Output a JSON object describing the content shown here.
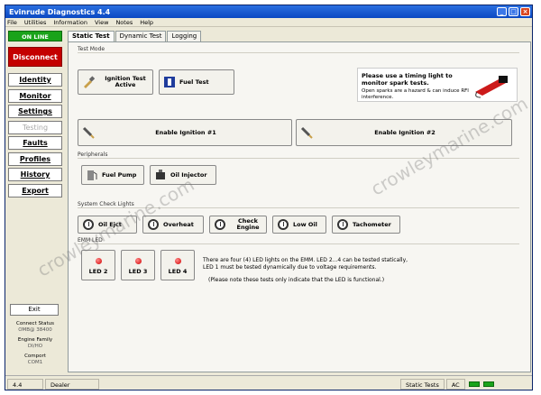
{
  "window": {
    "title": "Evinrude Diagnostics 4.4"
  },
  "menu": [
    "File",
    "Utilities",
    "Information",
    "View",
    "Notes",
    "Help"
  ],
  "sidebar": {
    "status": "ON LINE",
    "disconnect": "Disconnect",
    "items": [
      {
        "label": "Identity",
        "enabled": true
      },
      {
        "label": "Monitor",
        "enabled": true
      },
      {
        "label": "Settings",
        "enabled": true
      },
      {
        "label": "Testing",
        "enabled": false
      },
      {
        "label": "Faults",
        "enabled": true
      },
      {
        "label": "Profiles",
        "enabled": true
      },
      {
        "label": "History",
        "enabled": true
      },
      {
        "label": "Export",
        "enabled": true
      }
    ],
    "exit": "Exit",
    "connect_status_label": "Connect Status",
    "connect_status_value": "OMB@ 38400",
    "engine_family_label": "Engine Family",
    "engine_family_value": "DI/HO",
    "comport_label": "Comport",
    "comport_value": "COM1"
  },
  "tabs": [
    {
      "label": "Static Test",
      "active": true
    },
    {
      "label": "Dynamic Test",
      "active": false
    },
    {
      "label": "Logging",
      "active": false
    }
  ],
  "sections": {
    "test_mode": "Test Mode",
    "peripherals": "Peripherals",
    "lights": "System Check Lights",
    "emm_led": "EMM LED"
  },
  "test_mode": {
    "ignition_active": "Ignition Test Active",
    "fuel_test": "Fuel Test",
    "warning_title": "Please use a timing light to monitor spark tests.",
    "warning_text": "Open sparks are a hazard & can induce RFI interference."
  },
  "ignition": {
    "enable1": "Enable Ignition #1",
    "enable2": "Enable Ignition #2"
  },
  "peripherals": {
    "fuel_pump": "Fuel Pump",
    "oil_injector": "Oil Injector"
  },
  "lights": [
    "Oil Ejct",
    "Overheat",
    "Check Engine",
    "Low Oil",
    "Tachometer"
  ],
  "leds": [
    "LED 2",
    "LED 3",
    "LED 4"
  ],
  "led_note_1": "There are four (4) LED lights on the EMM. LED 2...4 can be tested statically, LED 1 must be tested dynamically due to voltage requirements.",
  "led_note_2": "(Please note these tests only indicate that the LED is functional.)",
  "statusbar": {
    "version": "4.4",
    "role": "Dealer",
    "mode": "Static Tests",
    "ac": "AC"
  },
  "watermark": "crowleymarine.com"
}
